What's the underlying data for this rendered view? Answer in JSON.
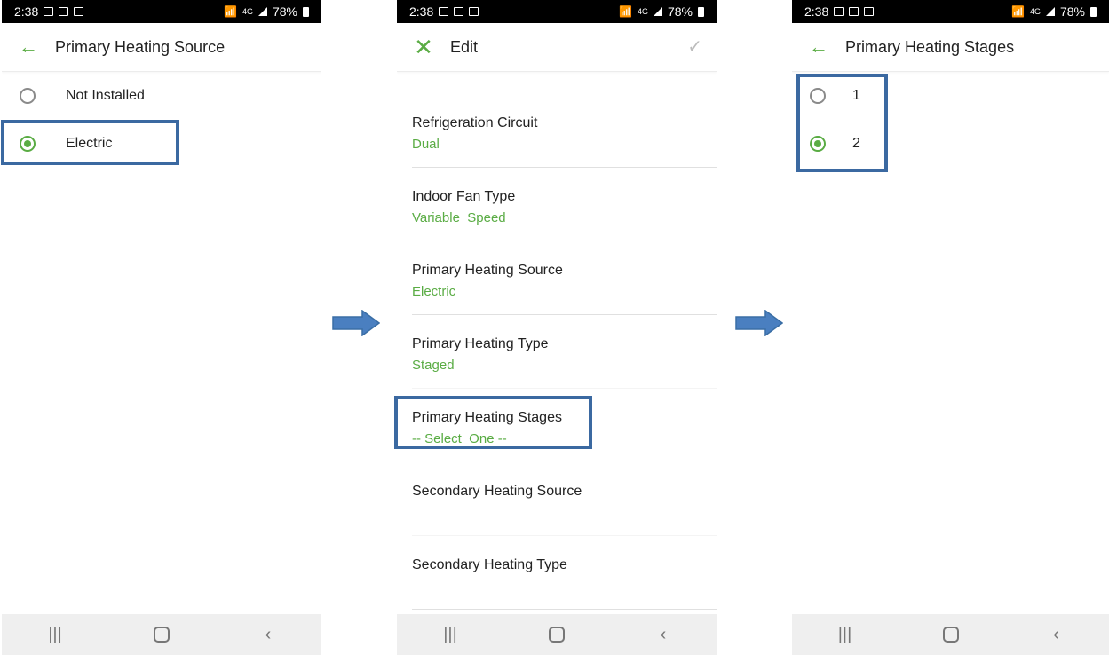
{
  "status_bar": {
    "time": "2:38",
    "battery": "78%",
    "network": "4G"
  },
  "screen1": {
    "title": "Primary Heating Source",
    "options": [
      {
        "label": "Not Installed",
        "selected": false
      },
      {
        "label": "Electric",
        "selected": true
      }
    ]
  },
  "screen2": {
    "title": "Edit",
    "items": [
      {
        "name": "Refrigeration Circuit",
        "value": "Dual"
      },
      {
        "name": "Indoor Fan Type",
        "value": "Variable  Speed"
      },
      {
        "name": "Primary Heating Source",
        "value": "Electric"
      },
      {
        "name": "Primary Heating Type",
        "value": "Staged"
      },
      {
        "name": "Primary Heating Stages",
        "value": "-- Select  One --"
      },
      {
        "name": "Secondary Heating Source",
        "value": ""
      },
      {
        "name": "Secondary Heating Type",
        "value": ""
      }
    ]
  },
  "screen3": {
    "title": "Primary Heating Stages",
    "options": [
      {
        "label": "1",
        "selected": false
      },
      {
        "label": "2",
        "selected": true
      }
    ]
  },
  "icons": {
    "back": "arrow-left-icon",
    "close": "close-icon",
    "confirm": "check-icon",
    "nav_recent": "recent-apps-icon",
    "nav_home": "home-icon",
    "nav_back": "chevron-left-icon",
    "flow_arrow": "arrow-right-icon"
  },
  "colors": {
    "accent": "#5aac44",
    "highlight": "#3b69a1",
    "status_bar": "#000000",
    "nav_bar": "#efefef"
  }
}
